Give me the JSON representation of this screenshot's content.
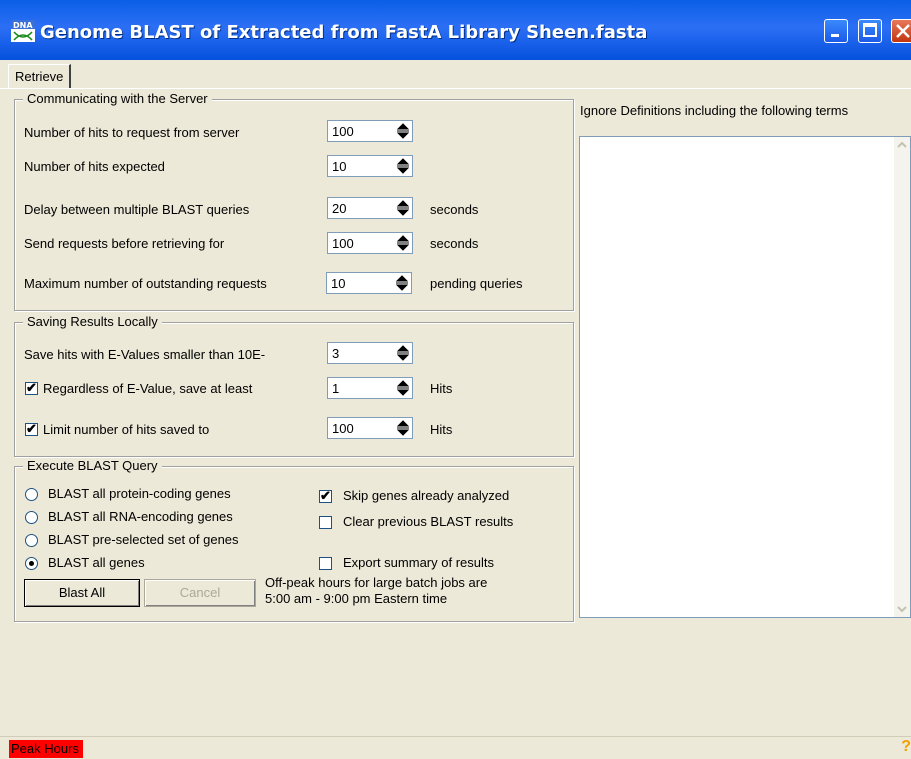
{
  "window": {
    "title": "Genome BLAST of Extracted from FastA Library Sheen.fasta",
    "accent": "#0a5fe6",
    "icons": [
      "dna-app-icon",
      "minimize-icon",
      "maximize-icon",
      "close-icon"
    ]
  },
  "tabs": [
    {
      "label": "Retrieve",
      "selected": true
    }
  ],
  "server": {
    "legend": "Communicating with the Server",
    "rows": [
      {
        "label": "Number of hits to request from server",
        "value": "100",
        "unit": ""
      },
      {
        "label": "Number of hits expected",
        "value": "10",
        "unit": ""
      },
      {
        "label": "Delay between multiple BLAST queries",
        "value": "20",
        "unit": "seconds"
      },
      {
        "label": "Send requests before retrieving for",
        "value": "100",
        "unit": "seconds"
      },
      {
        "label": "Maximum number of outstanding requests",
        "value": "10",
        "unit": "pending queries"
      }
    ]
  },
  "saving": {
    "legend": "Saving Results Locally",
    "evalue_label": "Save hits with E-Values smaller than 10E-",
    "evalue_value": "3",
    "save_at_least_label": "Regardless of E-Value, save at least",
    "save_at_least_checked": true,
    "save_at_least_value": "1",
    "save_at_least_unit": "Hits",
    "limit_label": "Limit number of hits saved to",
    "limit_checked": true,
    "limit_value": "100",
    "limit_unit": "Hits"
  },
  "execute": {
    "legend": "Execute BLAST Query",
    "radios": [
      {
        "label": "BLAST all protein-coding genes",
        "selected": false
      },
      {
        "label": "BLAST all RNA-encoding genes",
        "selected": false
      },
      {
        "label": "BLAST pre-selected set of genes",
        "selected": false
      },
      {
        "label": "BLAST all genes",
        "selected": true
      }
    ],
    "checks": [
      {
        "label": "Skip genes already analyzed",
        "checked": true
      },
      {
        "label": "Clear previous BLAST results",
        "checked": false
      },
      {
        "label": "Export summary of results",
        "checked": false
      }
    ],
    "blast_all_label": "Blast All",
    "cancel_label": "Cancel",
    "offpeak_line1": "Off-peak hours for large batch jobs are",
    "offpeak_line2": "5:00 am - 9:00 pm Eastern time"
  },
  "ignore": {
    "label": "Ignore Definitions including the following terms"
  },
  "status": {
    "peak_label": "Peak Hours",
    "peak_color": "#ff0000",
    "help_glyph": "?"
  }
}
